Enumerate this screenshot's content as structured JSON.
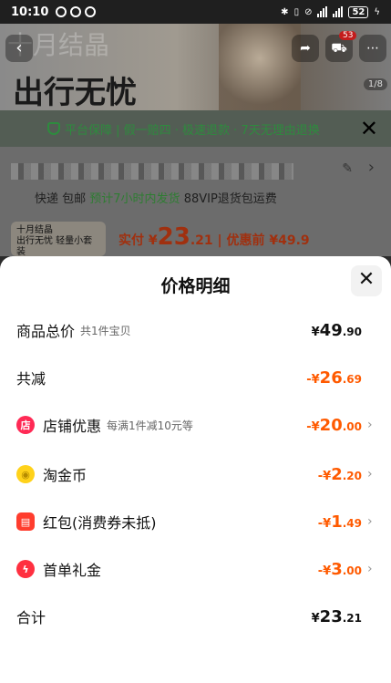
{
  "status_bar": {
    "time": "10:10",
    "battery": "52"
  },
  "background": {
    "watermark": "十月结晶",
    "hero_title": "出行无忧",
    "cart_badge_1": "53",
    "page_counter": "1/8",
    "guarantee_text": "平台保障 | 假一赔四 · 极速退款 · 7天无理由退换",
    "delivery_prefix": "快递 包邮",
    "delivery_green": "预计7小时内发货",
    "delivery_suffix": "88VIP退货包运费",
    "item_thumb_top": "十月结晶",
    "item_thumb_bottom": "出行无忧 轻量小套装",
    "price_label": "实付",
    "price_currency": "¥",
    "price_int": "23",
    "price_dec": ".21",
    "pre_discount": "| 优惠前 ¥49.9"
  },
  "sheet": {
    "title": "价格明细",
    "rows": [
      {
        "label": "商品总价",
        "sub": "共1件宝贝",
        "cur": "¥",
        "int": "49",
        "dec": ".90"
      },
      {
        "label": "共减",
        "sub": "",
        "cur": "-¥",
        "int": "26",
        "dec": ".69"
      },
      {
        "label": "店铺优惠",
        "sub": "每满1件减10元等",
        "cur": "-¥",
        "int": "20",
        "dec": ".00",
        "icon": "shop-icon"
      },
      {
        "label": "淘金币",
        "sub": "",
        "cur": "-¥",
        "int": "2",
        "dec": ".20",
        "icon": "coin-icon"
      },
      {
        "label": "红包(消费券未抵)",
        "sub": "",
        "cur": "-¥",
        "int": "1",
        "dec": ".49",
        "icon": "red-packet-icon"
      },
      {
        "label": "首单礼金",
        "sub": "",
        "cur": "-¥",
        "int": "3",
        "dec": ".00",
        "icon": "lightning-icon"
      },
      {
        "label": "合计",
        "sub": "",
        "cur": "¥",
        "int": "23",
        "dec": ".21"
      }
    ]
  },
  "colors": {
    "accent_orange": "#ff5a00",
    "green": "#2e8b3e",
    "shop_red": "#ff2a55",
    "coin_yellow": "#ffd21a"
  }
}
